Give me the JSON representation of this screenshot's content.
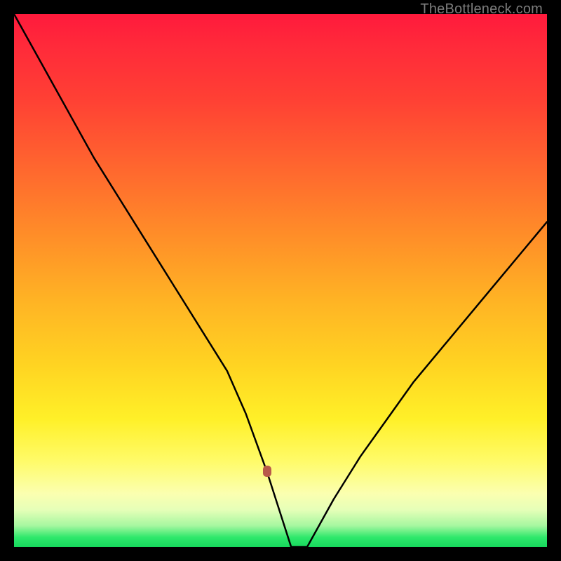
{
  "watermark": "TheBottleneck.com",
  "marker": {
    "color": "#b85a4a",
    "x_index": 10,
    "y": 0
  },
  "chart_data": {
    "type": "line",
    "title": "",
    "xlabel": "",
    "ylabel": "",
    "ylim": [
      0,
      100
    ],
    "xlim": [
      0,
      20
    ],
    "x": [
      0,
      1,
      2,
      3,
      4,
      5,
      6,
      7,
      8,
      8.7,
      9.5,
      10.4,
      11,
      12,
      13,
      14,
      15,
      16,
      17,
      18,
      19,
      20
    ],
    "values": [
      100,
      91,
      82,
      73,
      65,
      57,
      49,
      41,
      33,
      25,
      14,
      0,
      0,
      9,
      17,
      24,
      31,
      37,
      43,
      49,
      55,
      61
    ],
    "notes": "V-shaped bottleneck curve. Green band at bottom indicates minimal bottleneck; red at top indicates severe. Minimum (optimal) point near x≈10 marked with a small rounded rectangle."
  }
}
